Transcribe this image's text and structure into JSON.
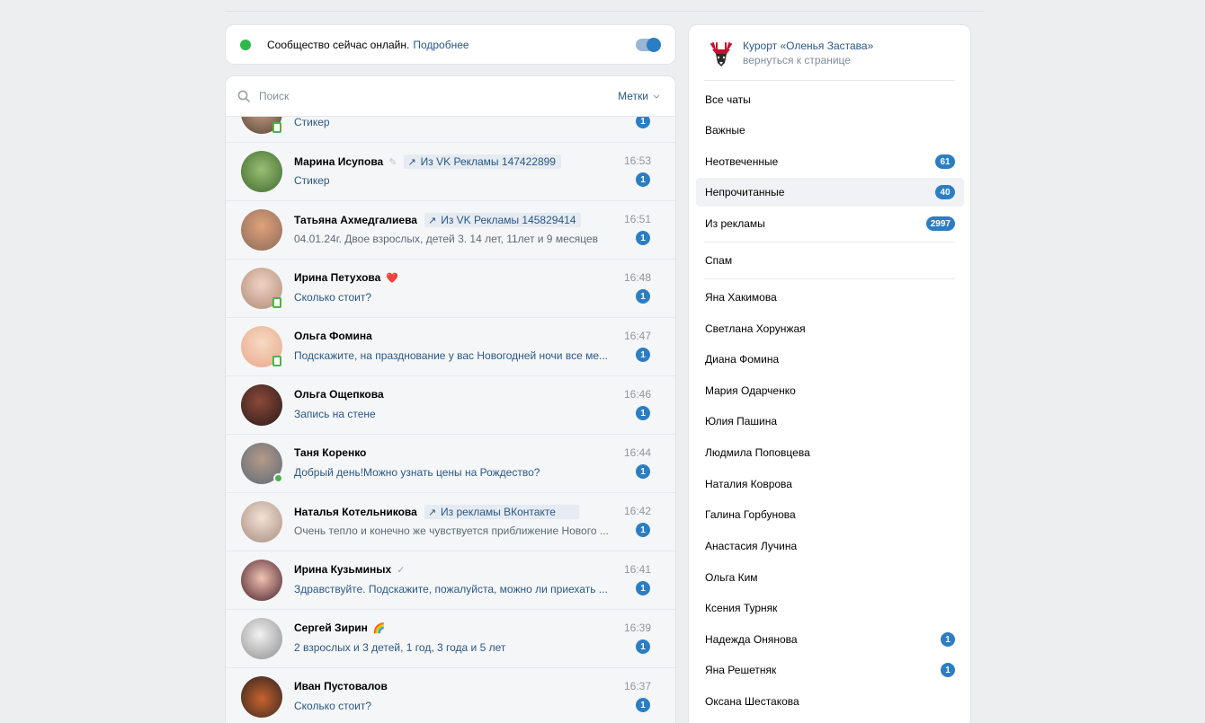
{
  "banner": {
    "text": "Сообщество сейчас онлайн.",
    "link": "Подробнее"
  },
  "search": {
    "placeholder": "Поиск",
    "tags_label": "Метки"
  },
  "partial_row": {
    "preview": "Стикер",
    "unread": "1"
  },
  "chats": [
    {
      "name": "Марина Исупова",
      "extra": "✎",
      "ad": "Из VK Рекламы 147422899",
      "time": "16:53",
      "preview": "Стикер",
      "unread": "1"
    },
    {
      "name": "Татьяна Ахмедгалиева",
      "extra": "",
      "ad": "Из VK Рекламы 145829414",
      "time": "16:51",
      "preview": "04.01.24г. Двое взрослых, детей 3. 14 лет, 11лет и 9 месяцев",
      "unread": "1"
    },
    {
      "name": "Ирина Петухова",
      "extra": "❤️",
      "ad": "",
      "time": "16:48",
      "preview": "Сколько стоит?",
      "unread": "1"
    },
    {
      "name": "Ольга Фомина",
      "extra": "",
      "ad": "",
      "time": "16:47",
      "preview": "Подскажите, на празднование у вас Новогодней ночи все ме...",
      "unread": "1"
    },
    {
      "name": "Ольга Ощепкова",
      "extra": "",
      "ad": "",
      "time": "16:46",
      "preview": "Запись на стене",
      "unread": "1"
    },
    {
      "name": "Таня Коренко",
      "extra": "",
      "ad": "",
      "time": "16:44",
      "preview": "Добрый день!Можно узнать цены на Рождество?",
      "unread": "1"
    },
    {
      "name": "Наталья Котельникова",
      "extra": "",
      "ad": "Из рекламы ВКонтакте",
      "time": "16:42",
      "preview": "Очень тепло и конечно же чувствуется приближение Нового ...",
      "unread": "1"
    },
    {
      "name": "Ирина Кузьминых",
      "extra": "✓",
      "ad": "",
      "time": "16:41",
      "preview": "Здравствуйте. Подскажите, пожалуйста, можно ли приехать ...",
      "unread": "1"
    },
    {
      "name": "Сергей Зирин",
      "extra": "🌈",
      "ad": "",
      "time": "16:39",
      "preview": "2 взрослых и 3 детей, 1 год, 3 года и 5 лет",
      "unread": "1"
    },
    {
      "name": "Иван Пустовалов",
      "extra": "",
      "ad": "",
      "time": "16:37",
      "preview": "Сколько стоит?",
      "unread": "1"
    }
  ],
  "side": {
    "community_name": "Курорт «Оленья Застава»",
    "back_link": "вернуться к странице",
    "menu": [
      {
        "label": "Все чаты",
        "count": ""
      },
      {
        "label": "Важные",
        "count": ""
      },
      {
        "label": "Неотвеченные",
        "count": "61"
      },
      {
        "label": "Непрочитанные",
        "count": "40"
      },
      {
        "label": "Из рекламы",
        "count": "2997"
      }
    ],
    "spam": "Спам",
    "managers": [
      {
        "label": "Яна Хакимова",
        "count": ""
      },
      {
        "label": "Светлана Хорунжая",
        "count": ""
      },
      {
        "label": "Диана Фомина",
        "count": ""
      },
      {
        "label": "Мария Одарченко",
        "count": ""
      },
      {
        "label": "Юлия Пашина",
        "count": ""
      },
      {
        "label": "Людмила Поповцева",
        "count": ""
      },
      {
        "label": "Наталия Коврова",
        "count": ""
      },
      {
        "label": "Галина Горбунова",
        "count": ""
      },
      {
        "label": "Анастасия Лучина",
        "count": ""
      },
      {
        "label": "Ольга Ким",
        "count": ""
      },
      {
        "label": "Ксения Турняк",
        "count": ""
      },
      {
        "label": "Надежда Онянова",
        "count": "1"
      },
      {
        "label": "Яна Решетняк",
        "count": "1"
      },
      {
        "label": "Оксана Шестакова",
        "count": ""
      }
    ]
  },
  "colors": {
    "accent": "#2b7ec3",
    "link": "#2a5885",
    "online": "#4bb34b"
  }
}
